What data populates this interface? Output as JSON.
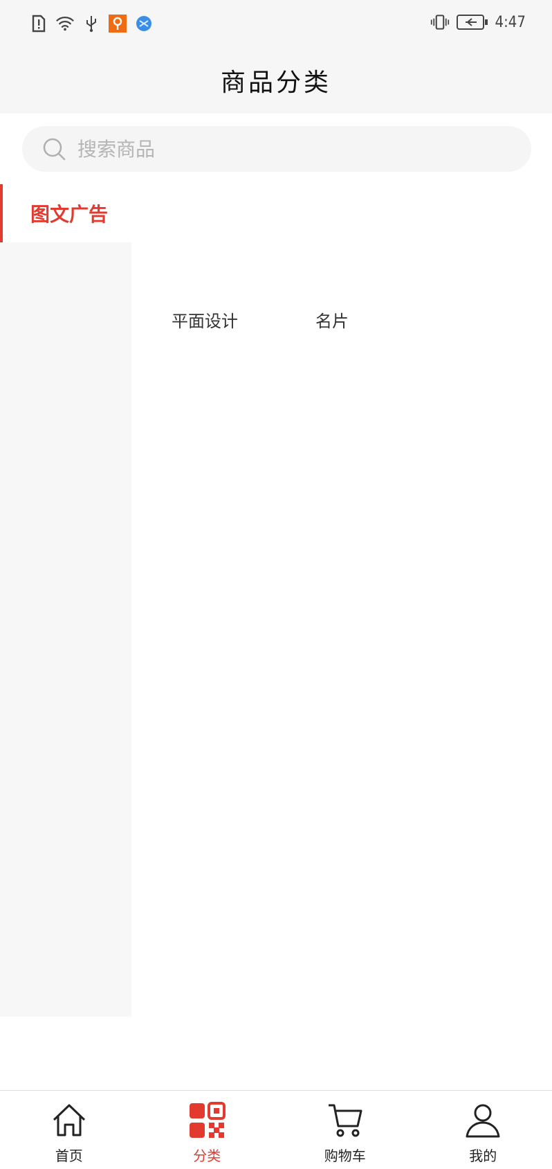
{
  "status_bar": {
    "time": "4:47"
  },
  "header": {
    "title": "商品分类"
  },
  "search": {
    "placeholder": "搜索商品"
  },
  "sidebar": {
    "items": [
      {
        "label": "图文广告",
        "active": true
      }
    ]
  },
  "content": {
    "subcategories": [
      "平面设计",
      "名片"
    ]
  },
  "tabs": [
    {
      "label": "首页",
      "icon": "home-icon"
    },
    {
      "label": "分类",
      "icon": "category-grid-icon",
      "active": true
    },
    {
      "label": "购物车",
      "icon": "cart-icon"
    },
    {
      "label": "我的",
      "icon": "user-icon"
    }
  ],
  "colors": {
    "accent": "#e23a2e",
    "background": "#f6f6f6"
  }
}
